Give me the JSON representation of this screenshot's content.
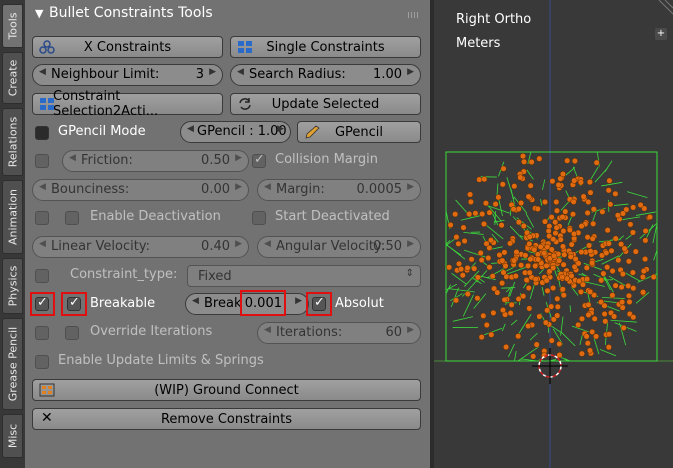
{
  "tabs": [
    "Tools",
    "Create",
    "Relations",
    "Animation",
    "Physics",
    "Grease Pencil",
    "Misc"
  ],
  "panel": {
    "title": "Bullet Constraints Tools",
    "x_constraints": "X Constraints",
    "single_constraints": "Single Constraints",
    "neighbour_limit": {
      "label": "Neighbour Limit:",
      "value": "3"
    },
    "search_radius": {
      "label": "Search Radius:",
      "value": "1.00"
    },
    "constraint_selection": "Constraint Selection2Acti...",
    "update_selected": "Update Selected",
    "gpencil_mode": "GPencil Mode",
    "gpencil_value": "GPencil : 1.00",
    "gpencil_button": "GPencil",
    "friction": {
      "label": "Friction:",
      "value": "0.50"
    },
    "collision_margin": "Collision Margin",
    "bounciness": {
      "label": "Bounciness:",
      "value": "0.00"
    },
    "margin": {
      "label": "Margin:",
      "value": "0.0005"
    },
    "enable_deactivation": "Enable Deactivation",
    "start_deactivated": "Start Deactivated",
    "linear_velocity": {
      "label": "Linear Velocity:",
      "value": "0.40"
    },
    "angular_velocity": {
      "label": "Angular Velocity:",
      "value": "0.50"
    },
    "constraint_type": {
      "label": "Constraint_type:",
      "value": "Fixed"
    },
    "breakable": "Breakable",
    "break": {
      "label": "Break",
      "value": "0.001"
    },
    "absolut": "Absolut",
    "override_iterations": "Override Iterations",
    "iterations": {
      "label": "Iterations:",
      "value": "60"
    },
    "enable_update_limits": "Enable Update Limits & Springs",
    "ground_connect": "(WIP) Ground Connect",
    "remove_constraints": "Remove Constraints"
  },
  "viewport": {
    "view_name": "Right Ortho",
    "units": "Meters"
  },
  "colors": {
    "panel": "#727272",
    "highlight": "#e01010",
    "voronoi": "#3cdc3c",
    "particles": "#e06a10"
  }
}
